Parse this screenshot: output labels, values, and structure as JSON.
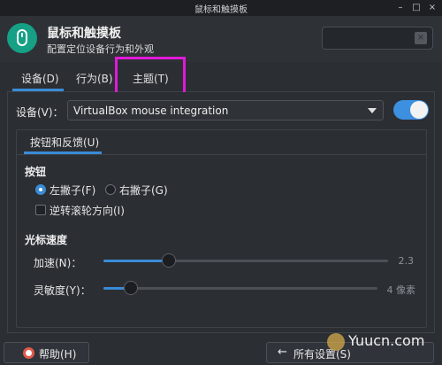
{
  "window": {
    "title": "鼠标和触摸板",
    "minimize": "–",
    "maximize": "□",
    "close": "×"
  },
  "header": {
    "title": "鼠标和触摸板",
    "subtitle": "配置定位设备行为和外观",
    "search_placeholder": "",
    "clear_glyph": "×"
  },
  "tabs": [
    {
      "label": "设备(D)",
      "active": true
    },
    {
      "label": "行为(B)",
      "active": false
    },
    {
      "label": "主题(T)",
      "active": false
    }
  ],
  "device": {
    "label": "设备(V)：",
    "selected": "VirtualBox mouse integration",
    "enabled": true
  },
  "subtab": {
    "label": "按钮和反馈(U)"
  },
  "buttons_section": {
    "title": "按钮",
    "left_handed": {
      "label": "左撇子(F)",
      "selected": true
    },
    "right_handed": {
      "label": "右撇子(G)",
      "selected": false
    },
    "reverse_scroll": {
      "label": "逆转滚轮方向(I)",
      "checked": false
    }
  },
  "pointer_speed": {
    "title": "光标速度",
    "acceleration": {
      "label": "加速(N)：",
      "value": "2.3",
      "fraction": 0.23
    },
    "sensitivity": {
      "label": "灵敏度(Y)：",
      "value": "4 像素",
      "fraction": 0.1
    }
  },
  "footer": {
    "help_label": "帮助(H)",
    "all_settings_label": "所有设置(S)",
    "back_glyph": "←"
  },
  "watermark": {
    "text": "Yuucn.com"
  },
  "colors": {
    "accent": "#3a8bd6",
    "app_icon": "#16a085",
    "highlight": "#e11ad8",
    "background": "#2b2e33"
  }
}
